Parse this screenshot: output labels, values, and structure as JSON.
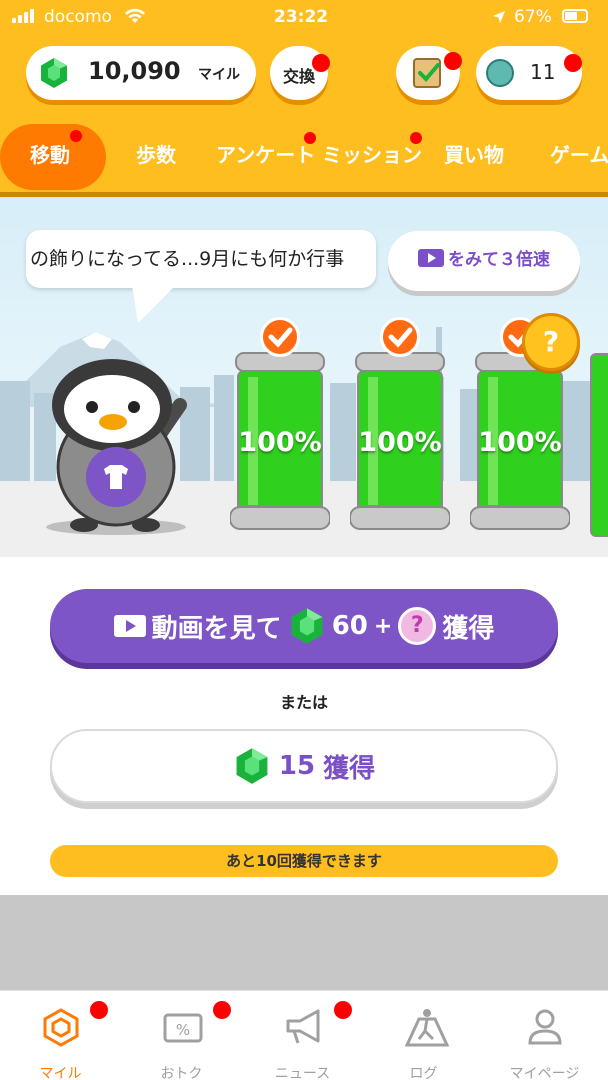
{
  "status_bar": {
    "carrier": "docomo",
    "time": "23:22",
    "battery": "67%"
  },
  "header": {
    "miles_value": "10,090",
    "miles_unit": "マイル",
    "exchange_label": "交換",
    "ticket_count": "11"
  },
  "tabs": [
    {
      "label": "移動",
      "active": true
    },
    {
      "label": "歩数"
    },
    {
      "label": "アンケート"
    },
    {
      "label": "ミッション"
    },
    {
      "label": "買い物"
    },
    {
      "label": "ゲーム"
    }
  ],
  "scene": {
    "speech_text": "の飾りになってる...9月にも何か行事",
    "speed_button_label": "をみて３倍速",
    "tank_labels": [
      "100%",
      "100%",
      "100%"
    ],
    "tank_levels": [
      1.0,
      1.0,
      1.0
    ],
    "mystery_badge": "?"
  },
  "actions": {
    "video_label": "動画を見て",
    "video_gems": "60",
    "video_plus": "+",
    "video_suffix": "獲得",
    "or_label": "または",
    "get_amount": "15",
    "get_suffix": "獲得",
    "remaining_label": "あと10回獲得できます"
  },
  "bottom_nav": [
    {
      "label": "マイル",
      "icon": "hexagon-miles-icon",
      "active": true
    },
    {
      "label": "おトク",
      "icon": "coupon-icon"
    },
    {
      "label": "ニュース",
      "icon": "megaphone-icon"
    },
    {
      "label": "ログ",
      "icon": "walking-road-icon"
    },
    {
      "label": "マイページ",
      "icon": "person-icon"
    }
  ],
  "colors": {
    "header": "#FFBE1F",
    "accent_orange": "#FF7A00",
    "purple": "#7E55C7",
    "gem_green": "#19B23B",
    "notification_red": "#FF0000"
  }
}
